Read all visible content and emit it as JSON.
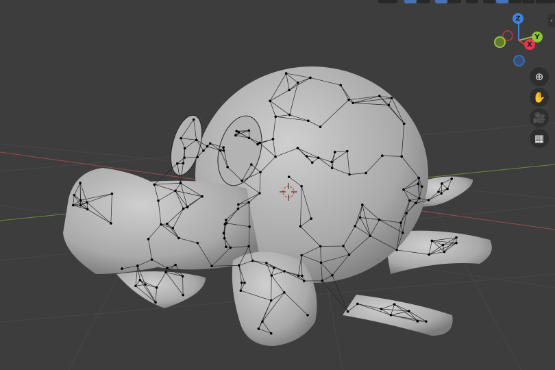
{
  "viewport": {
    "background": "#3d3d3d",
    "mode": "edit-mesh"
  },
  "gizmo": {
    "x_label": "X",
    "y_label": "Y",
    "z_label": "Z",
    "x_color": "#e8344f",
    "y_color": "#8bc53a",
    "z_color": "#3f82e0"
  },
  "nav_tools": [
    {
      "icon": "zoom-icon",
      "glyph": "⊕"
    },
    {
      "icon": "pan-hand-icon",
      "glyph": "✋"
    },
    {
      "icon": "camera-icon",
      "glyph": "🎥"
    },
    {
      "icon": "perspective-grid-icon",
      "glyph": "▦"
    }
  ],
  "sidebar_toggle": "‹"
}
